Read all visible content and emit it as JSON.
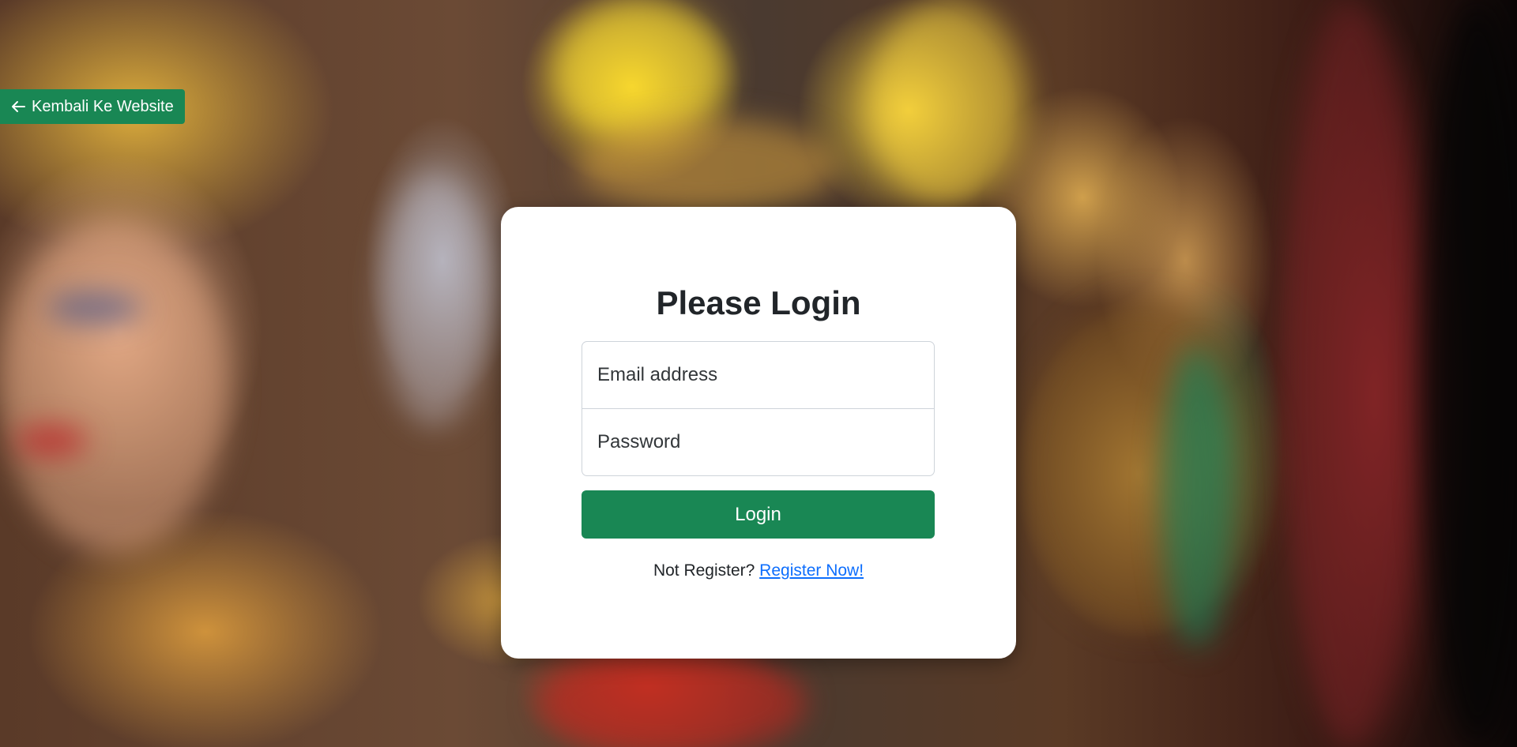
{
  "nav": {
    "back_label": "Kembali Ke Website"
  },
  "login": {
    "title": "Please Login",
    "email_placeholder": "Email address",
    "password_placeholder": "Password",
    "submit_label": "Login",
    "register_prompt": "Not Register?",
    "register_link": "Register Now!"
  },
  "colors": {
    "primary_green": "#198754",
    "link_blue": "#0d6efd",
    "card_bg": "#ffffff"
  },
  "icons": {
    "back": "arrow-left-icon"
  }
}
